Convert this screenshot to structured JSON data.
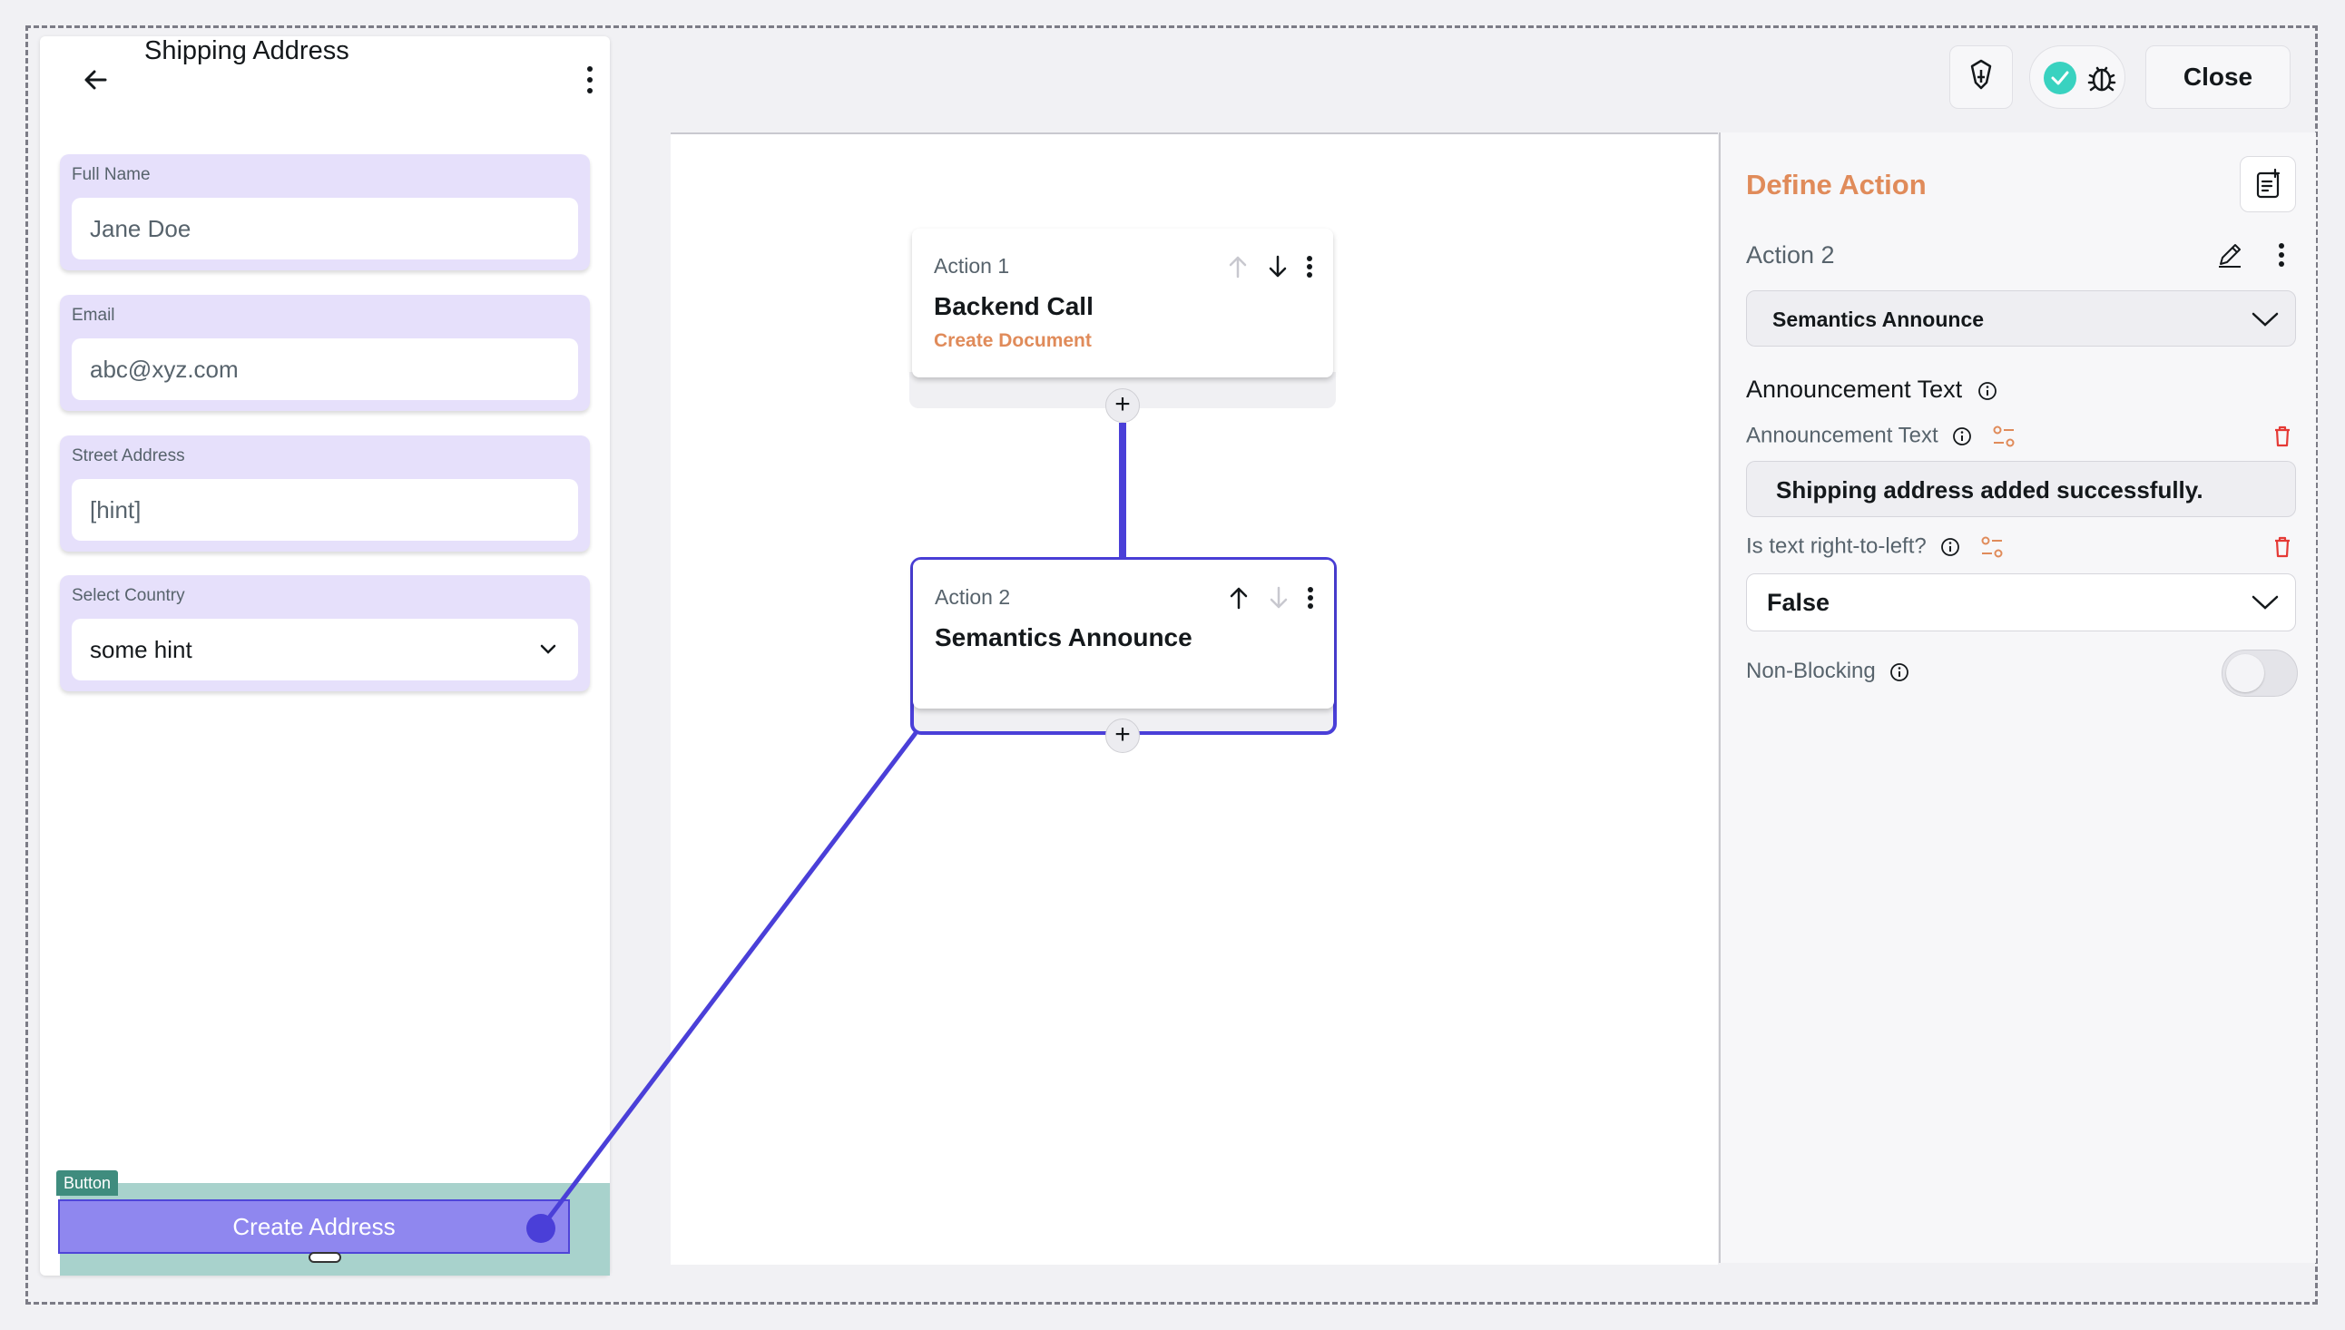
{
  "colors": {
    "accent": "#4a3fd8",
    "accent_fill": "#8f87ef",
    "field_bg": "#e6e0fb",
    "warning_orange": "#e08b5a",
    "danger_red": "#e53935",
    "success_teal": "#39d2c0",
    "widget_tag": "#3f8c7e"
  },
  "preview": {
    "title": "Shipping Address",
    "back_icon": "arrow-left-icon",
    "menu_icon": "more-vert-icon",
    "fields": [
      {
        "label": "Full Name",
        "value": "Jane Doe"
      },
      {
        "label": "Email",
        "value": "abc@xyz.com"
      },
      {
        "label": "Street Address",
        "value": "[hint]"
      },
      {
        "label": "Select Country",
        "value": "some hint"
      }
    ],
    "widget_tag": "Button",
    "button_label": "Create Address"
  },
  "toolbar": {
    "icons": [
      "pointer-icon",
      "check-circle-icon",
      "bug-icon"
    ],
    "close_label": "Close"
  },
  "canvas": {
    "actions": [
      {
        "label": "Action 1",
        "title": "Backend Call",
        "subtitle": "Create Document"
      },
      {
        "label": "Action 2",
        "title": "Semantics Announce",
        "subtitle": ""
      }
    ],
    "add_symbol": "+"
  },
  "panel": {
    "title": "Define Action",
    "action_name": "Action 2",
    "action_type": "Semantics Announce",
    "section_title": "Announcement Text",
    "announcement_label": "Announcement Text",
    "announcement_value": "Shipping address added successfully.",
    "rtl_label": "Is text right-to-left?",
    "rtl_value": "False",
    "nonblocking_label": "Non-Blocking",
    "nonblocking_on": false
  }
}
